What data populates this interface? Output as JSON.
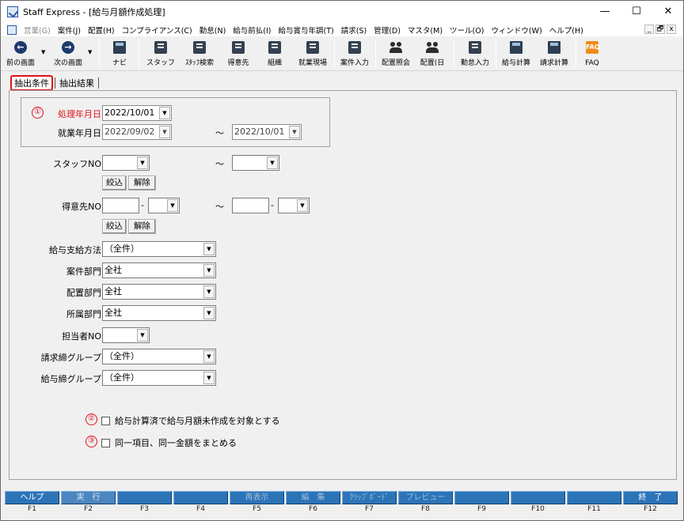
{
  "window": {
    "title": "Staff Express - [給与月額作成処理]",
    "controls": {
      "minimize": "—",
      "maximize": "☐",
      "close": "✕"
    }
  },
  "menubar": {
    "items": [
      {
        "label": "営業(G)",
        "disabled": true
      },
      {
        "label": "案件(J)"
      },
      {
        "label": "配置(H)"
      },
      {
        "label": "コンプライアンス(C)"
      },
      {
        "label": "勤怠(N)"
      },
      {
        "label": "給与前払(I)"
      },
      {
        "label": "給与賞与年調(T)"
      },
      {
        "label": "請求(S)"
      },
      {
        "label": "管理(D)"
      },
      {
        "label": "マスタ(M)"
      },
      {
        "label": "ツール(O)"
      },
      {
        "label": "ウィンドウ(W)"
      },
      {
        "label": "ヘルプ(H)"
      }
    ],
    "mdi_controls": {
      "minimize": "_",
      "restore": "🗗",
      "close": "x"
    }
  },
  "toolbar": {
    "buttons": [
      {
        "label": "前の画面",
        "icon": "arrow-left-icon",
        "glyph": "←"
      },
      {
        "label": "次の画面",
        "icon": "arrow-right-icon",
        "glyph": "→"
      },
      {
        "label": "ナビ",
        "icon": "navi-icon"
      },
      {
        "label": "スタッフ",
        "icon": "staff-icon"
      },
      {
        "label": "ｽﾀｯﾌ検索",
        "icon": "staff-search-icon"
      },
      {
        "label": "得意先",
        "icon": "client-icon"
      },
      {
        "label": "組織",
        "icon": "organization-icon"
      },
      {
        "label": "就業現場",
        "icon": "worksite-icon"
      },
      {
        "label": "案件入力",
        "icon": "job-entry-icon"
      },
      {
        "label": "配置照会",
        "icon": "placement-inquiry-icon"
      },
      {
        "label": "配置(日",
        "icon": "placement-daily-icon"
      },
      {
        "label": "勤怠入力",
        "icon": "attendance-entry-icon"
      },
      {
        "label": "給与計算",
        "icon": "payroll-calc-icon"
      },
      {
        "label": "請求計算",
        "icon": "billing-calc-icon"
      },
      {
        "label": "FAQ",
        "icon": "faq-icon",
        "glyph": "FAQ"
      }
    ],
    "dropdown_glyph": "▼"
  },
  "tabs": [
    {
      "label": "抽出条件",
      "active": true
    },
    {
      "label": "抽出結果",
      "active": false
    }
  ],
  "form": {
    "processing_date": {
      "badge": "①",
      "label": "処理年月日",
      "value": "2022/10/01"
    },
    "work_date": {
      "label": "就業年月日",
      "from": "2022/09/02",
      "to": "2022/10/01"
    },
    "range_sep": "～",
    "staff_no": {
      "label": "スタッフNO",
      "from": "",
      "to": ""
    },
    "client_no": {
      "label": "得意先NO",
      "from_a": "",
      "from_b": "",
      "to_a": "",
      "to_b": "",
      "dash": "-"
    },
    "filter_button": "絞込",
    "clear_button": "解除",
    "pay_method": {
      "label": "給与支給方法",
      "value": "（全件）"
    },
    "project_dept": {
      "label": "案件部門",
      "value": "全社"
    },
    "placement_dept": {
      "label": "配置部門",
      "value": "全社"
    },
    "belong_dept": {
      "label": "所属部門",
      "value": "全社"
    },
    "staff_in_charge": {
      "label": "担当者NO",
      "value": ""
    },
    "billing_group": {
      "label": "請求締グループ",
      "value": "（全件）"
    },
    "payroll_group": {
      "label": "給与締グループ",
      "value": "（全件）"
    },
    "option2": {
      "badge": "②",
      "label": "給与計算済で給与月額未作成を対象とする",
      "checked": false
    },
    "option3": {
      "badge": "③",
      "label": "同一項目、同一金額をまとめる",
      "checked": false
    }
  },
  "fkeys": [
    {
      "label": "ヘルプ",
      "key": "F1",
      "state": "normal"
    },
    {
      "label": "実　行",
      "key": "F2",
      "state": "pressed"
    },
    {
      "label": "",
      "key": "F3",
      "state": "blank"
    },
    {
      "label": "",
      "key": "F4",
      "state": "blank"
    },
    {
      "label": "再表示",
      "key": "F5",
      "state": "dim"
    },
    {
      "label": "編　集",
      "key": "F6",
      "state": "dim"
    },
    {
      "label": "ｸﾘｯﾌﾟﾎﾞｰﾄﾞ",
      "key": "F7",
      "state": "dim"
    },
    {
      "label": "プレビュー",
      "key": "F8",
      "state": "dim"
    },
    {
      "label": "",
      "key": "F9",
      "state": "blank"
    },
    {
      "label": "",
      "key": "F10",
      "state": "blank"
    },
    {
      "label": "",
      "key": "F11",
      "state": "blank"
    },
    {
      "label": "終　了",
      "key": "F12",
      "state": "normal"
    }
  ]
}
